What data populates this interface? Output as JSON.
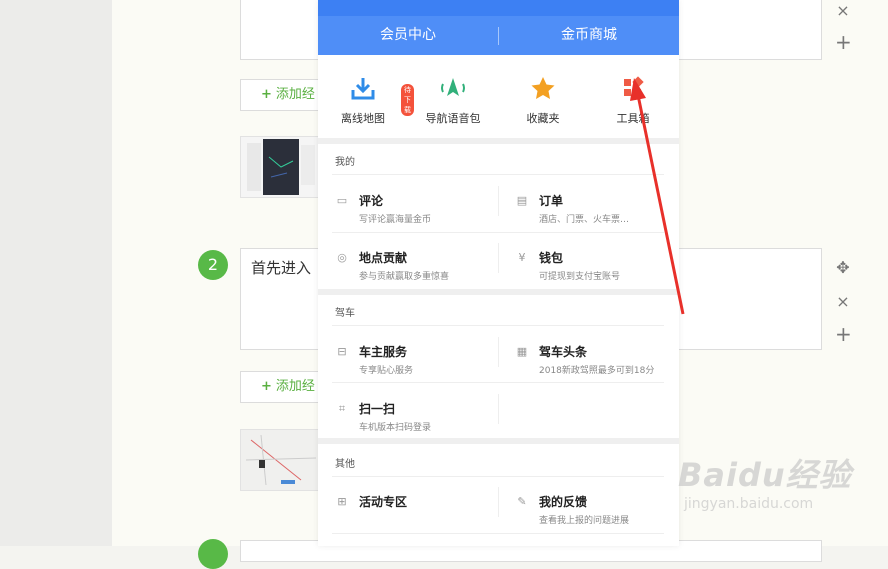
{
  "phone": {
    "header_tabs": [
      "会员中心",
      "金币商城"
    ],
    "quick_items": [
      {
        "label": "离线地图",
        "icon": "download-icon",
        "badge": "待下载"
      },
      {
        "label": "导航语音包",
        "icon": "voice-nav-icon"
      },
      {
        "label": "收藏夹",
        "icon": "star-icon"
      },
      {
        "label": "工具箱",
        "icon": "toolbox-icon"
      }
    ],
    "sections": [
      {
        "title": "我的",
        "items": [
          {
            "title": "评论",
            "sub": "写评论赢海量金币",
            "icon": "comment-icon"
          },
          {
            "title": "订单",
            "sub": "酒店、门票、火车票…",
            "icon": "order-icon"
          },
          {
            "title": "地点贡献",
            "sub": "参与贡献赢取多重惊喜",
            "icon": "medal-icon"
          },
          {
            "title": "钱包",
            "sub": "可提现到支付宝账号",
            "icon": "wallet-icon"
          }
        ]
      },
      {
        "title": "驾车",
        "items": [
          {
            "title": "车主服务",
            "sub": "专享贴心服务",
            "icon": "car-icon"
          },
          {
            "title": "驾车头条",
            "sub": "2018新政驾照最多可到18分",
            "icon": "news-icon"
          },
          {
            "title": "扫一扫",
            "sub": "车机版本扫码登录",
            "icon": "scan-icon"
          }
        ]
      },
      {
        "title": "其他",
        "items": [
          {
            "title": "活动专区",
            "sub": "",
            "icon": "gift-icon"
          },
          {
            "title": "我的反馈",
            "sub": "查看我上报的问题进展",
            "icon": "feedback-icon"
          }
        ]
      }
    ]
  },
  "editor": {
    "add_button_label": "添加经",
    "step_number": "2",
    "step_text": "首先进入",
    "close_icon": "×",
    "add_icon": "+",
    "move_icon": "✥"
  },
  "watermark": {
    "brand": "Baidu经验",
    "url": "jingyan.baidu.com"
  },
  "colors": {
    "header_blue": "#4f8ef7",
    "accent_green": "#58b947",
    "arrow_red": "#e8302a"
  }
}
